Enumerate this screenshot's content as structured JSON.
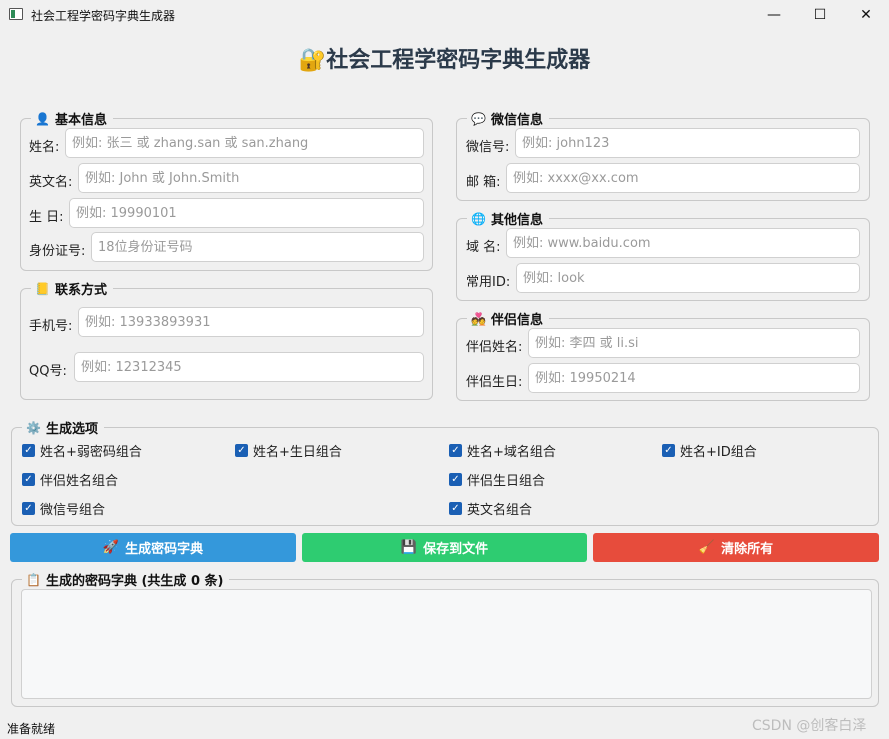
{
  "window": {
    "title": "社会工程学密码字典生成器",
    "min": "—",
    "max": "☐",
    "close": "✕"
  },
  "main_title": "🔐社会工程学密码字典生成器",
  "basic": {
    "legend": "基本信息",
    "icon": "👤",
    "name_label": "姓名:",
    "name_ph": "例如: 张三 或 zhang.san 或 san.zhang",
    "en_label": "英文名:",
    "en_ph": "例如: John 或 John.Smith",
    "birth_label": "生 日:",
    "birth_ph": "例如: 19990101",
    "id_label": "身份证号:",
    "id_ph": "18位身份证号码"
  },
  "contact": {
    "legend": "联系方式",
    "icon": "📒",
    "phone_label": "手机号:",
    "phone_ph": "例如: 13933893931",
    "qq_label": "QQ号:",
    "qq_ph": "例如: 12312345"
  },
  "wechat": {
    "legend": "微信信息",
    "icon": "💬",
    "wx_label": "微信号:",
    "wx_ph": "例如: john123",
    "mail_label": "邮 箱:",
    "mail_ph": "例如: xxxx@xx.com"
  },
  "other": {
    "legend": "其他信息",
    "icon": "🌐",
    "domain_label": "域 名:",
    "domain_ph": "例如: www.baidu.com",
    "cid_label": "常用ID:",
    "cid_ph": "例如: look"
  },
  "partner": {
    "legend": "伴侣信息",
    "icon": "💑",
    "pname_label": "伴侣姓名:",
    "pname_ph": "例如: 李四 或 li.si",
    "pbirth_label": "伴侣生日:",
    "pbirth_ph": "例如: 19950214"
  },
  "options": {
    "legend": "生成选项",
    "icon": "⚙️",
    "items": [
      "姓名+弱密码组合",
      "姓名+生日组合",
      "姓名+域名组合",
      "姓名+ID组合",
      "伴侣姓名组合",
      "伴侣生日组合",
      "微信号组合",
      "英文名组合"
    ],
    "check": "✓"
  },
  "actions": {
    "generate": {
      "label": "生成密码字典",
      "icon": "🚀",
      "color": "#3498db"
    },
    "save": {
      "label": "保存到文件",
      "icon": "💾",
      "color": "#2ecc71"
    },
    "clear": {
      "label": "清除所有",
      "icon": "🧹",
      "color": "#e74c3c"
    }
  },
  "result": {
    "legend": "生成的密码字典 (共生成 0 条)",
    "icon": "📋"
  },
  "status": "准备就绪",
  "watermark": "CSDN @创客白泽"
}
